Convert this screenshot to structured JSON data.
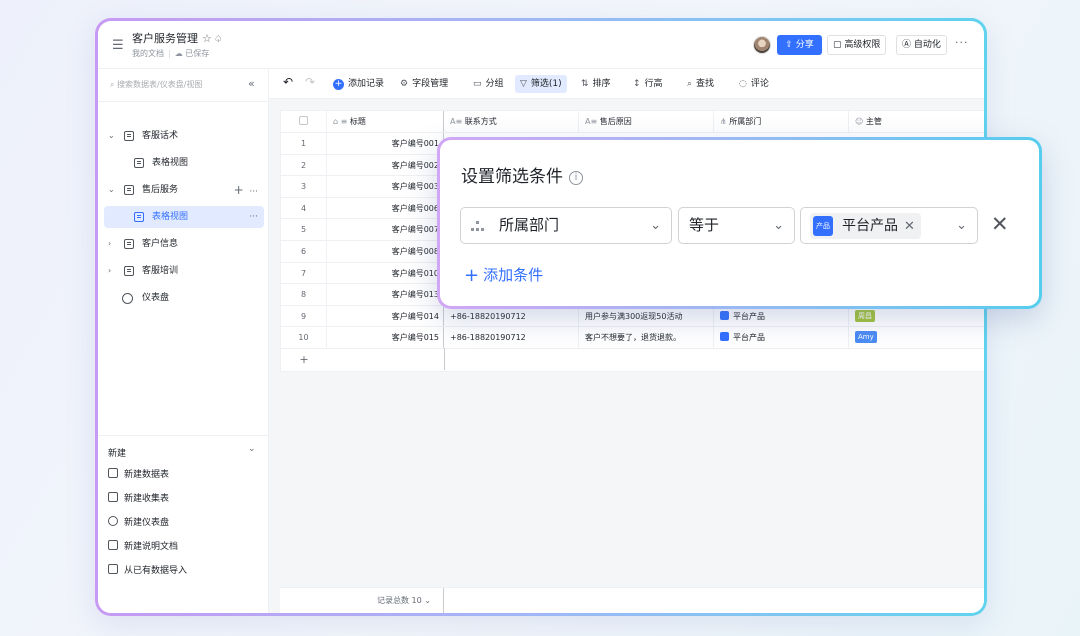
{
  "header": {
    "title": "客户服务管理",
    "breadcrumb": "我的文档",
    "save_status": "已保存",
    "share_label": "分享",
    "advanced_perm_label": "高级权限",
    "automation_label": "自动化",
    "more_label": "···"
  },
  "sidebar": {
    "search_placeholder": "搜索数据表/仪表盘/视图",
    "items": [
      {
        "label": "客服话术",
        "type": "table",
        "expanded": true
      },
      {
        "label": "表格视图",
        "type": "view"
      },
      {
        "label": "售后服务",
        "type": "table",
        "expanded": true
      },
      {
        "label": "表格视图",
        "type": "view",
        "active": true
      },
      {
        "label": "客户信息",
        "type": "table",
        "expanded": false
      },
      {
        "label": "客服培训",
        "type": "table",
        "expanded": false
      },
      {
        "label": "仪表盘",
        "type": "dashboard"
      }
    ],
    "new_section": {
      "header": "新建",
      "items": [
        "新建数据表",
        "新建收集表",
        "新建仪表盘",
        "新建说明文档",
        "从已有数据导入"
      ]
    }
  },
  "toolbar": {
    "add_record": "添加记录",
    "field_manage": "字段管理",
    "group": "分组",
    "filter": "筛选(1)",
    "sort": "排序",
    "row_height": "行高",
    "find": "查找",
    "comment": "评论"
  },
  "grid": {
    "columns": [
      "标题",
      "联系方式",
      "售后原因",
      "所属部门",
      "主管"
    ],
    "rows": [
      {
        "n": "1",
        "title": "客户编号001",
        "contact": "",
        "reason": "",
        "dept": "",
        "owner": ""
      },
      {
        "n": "2",
        "title": "客户编号002",
        "contact": "",
        "reason": "",
        "dept": "",
        "owner": ""
      },
      {
        "n": "3",
        "title": "客户编号003",
        "contact": "",
        "reason": "",
        "dept": "",
        "owner": ""
      },
      {
        "n": "4",
        "title": "客户编号006",
        "contact": "",
        "reason": "",
        "dept": "",
        "owner": ""
      },
      {
        "n": "5",
        "title": "客户编号007",
        "contact": "",
        "reason": "",
        "dept": "",
        "owner": ""
      },
      {
        "n": "6",
        "title": "客户编号008",
        "contact": "",
        "reason": "",
        "dept": "",
        "owner": ""
      },
      {
        "n": "7",
        "title": "客户编号010",
        "contact": "",
        "reason": "",
        "dept": "",
        "owner": ""
      },
      {
        "n": "8",
        "title": "客户编号013",
        "contact": "",
        "reason": "",
        "dept": "",
        "owner": ""
      },
      {
        "n": "9",
        "title": "客户编号014",
        "contact": "+86-18820190712",
        "reason": "用户参与满300返现50活动",
        "dept": "平台产品",
        "owner": "周昌",
        "owner_color": "#a3c43a"
      },
      {
        "n": "10",
        "title": "客户编号015",
        "contact": "+86-18820190712",
        "reason": "客户不想要了，退货退款。",
        "dept": "平台产品",
        "owner": "Amy",
        "owner_color": "#4c8bf5"
      }
    ],
    "add_row": "+",
    "record_total": "记录总数 10"
  },
  "filter_popup": {
    "title": "设置筛选条件",
    "info": "i",
    "field": "所属部门",
    "operator": "等于",
    "value_chip": "平台产品",
    "value_chip_icon_text": "产品",
    "close": "✕",
    "add_condition": "添加条件"
  },
  "colors": {
    "accent": "#3370ff",
    "active_bg": "#e1eaff",
    "frame_start": "#c79af3",
    "frame_end": "#5fd3ee"
  }
}
